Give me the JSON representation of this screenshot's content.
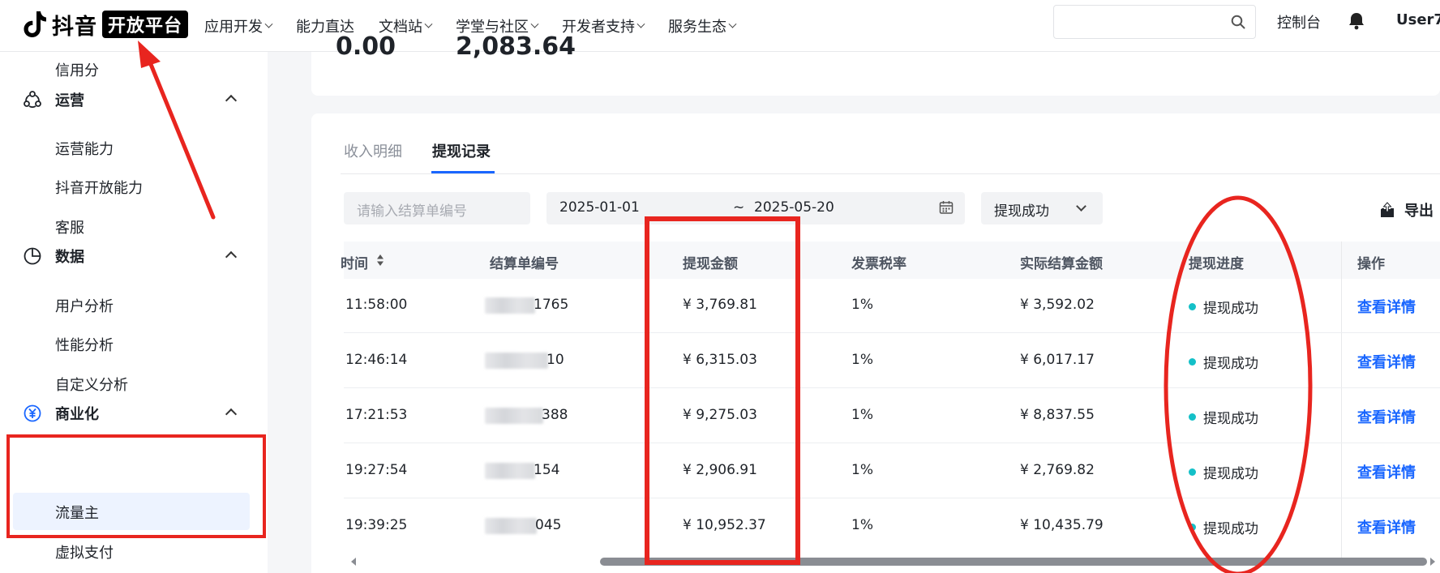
{
  "header": {
    "logo_text": "抖音",
    "logo_badge": "开放平台",
    "nav": [
      {
        "label": "应用开发",
        "dropdown": true
      },
      {
        "label": "能力直达",
        "dropdown": false
      },
      {
        "label": "文档站",
        "dropdown": true
      },
      {
        "label": "学堂与社区",
        "dropdown": true
      },
      {
        "label": "开发者支持",
        "dropdown": true
      },
      {
        "label": "服务生态",
        "dropdown": true
      }
    ],
    "search_placeholder": "",
    "console_label": "控制台",
    "user_label": "User7"
  },
  "sidebar": {
    "credit": "信用分",
    "ops": {
      "label": "运营",
      "items": [
        "运营能力",
        "抖音开放能力",
        "客服"
      ]
    },
    "data": {
      "label": "数据",
      "items": [
        "用户分析",
        "性能分析",
        "自定义分析"
      ]
    },
    "biz": {
      "label": "商业化",
      "items": [
        "流量主",
        "虚拟支付"
      ],
      "active": "流量主"
    }
  },
  "summary": {
    "left_value": "0.00",
    "right_value": "2,083.64"
  },
  "tabs": [
    {
      "label": "收入明细",
      "active": false
    },
    {
      "label": "提现记录",
      "active": true
    }
  ],
  "filters": {
    "settlement_placeholder": "请输入结算单编号",
    "date_start": "2025-01-01",
    "date_sep": "~",
    "date_end": "2025-05-20",
    "status_value": "提现成功",
    "export_label": "导出"
  },
  "table": {
    "columns": [
      "时间",
      "结算单编号",
      "提现金额",
      "发票税率",
      "实际结算金额",
      "提现进度",
      "操作"
    ],
    "rows": [
      {
        "time": "11:58:00",
        "id_suffix": "1765",
        "amount": "¥ 3,769.81",
        "tax": "1%",
        "actual": "¥ 3,592.02",
        "status": "提现成功",
        "action": "查看详情"
      },
      {
        "time": "12:46:14",
        "id_suffix": "10",
        "amount": "¥ 6,315.03",
        "tax": "1%",
        "actual": "¥ 6,017.17",
        "status": "提现成功",
        "action": "查看详情"
      },
      {
        "time": "17:21:53",
        "id_suffix": "388",
        "amount": "¥ 9,275.03",
        "tax": "1%",
        "actual": "¥ 8,837.55",
        "status": "提现成功",
        "action": "查看详情"
      },
      {
        "time": "19:27:54",
        "id_suffix": "154",
        "amount": "¥ 2,906.91",
        "tax": "1%",
        "actual": "¥ 2,769.82",
        "status": "提现成功",
        "action": "查看详情"
      },
      {
        "time": "19:39:25",
        "id_suffix": "045",
        "amount": "¥ 10,952.37",
        "tax": "1%",
        "actual": "¥ 10,435.79",
        "status": "提现成功",
        "action": "查看详情"
      }
    ]
  },
  "colors": {
    "accent": "#1966ff",
    "status_dot": "#14c0c8",
    "annotation_red": "#e8251f",
    "active_bg": "#edf3ff"
  }
}
